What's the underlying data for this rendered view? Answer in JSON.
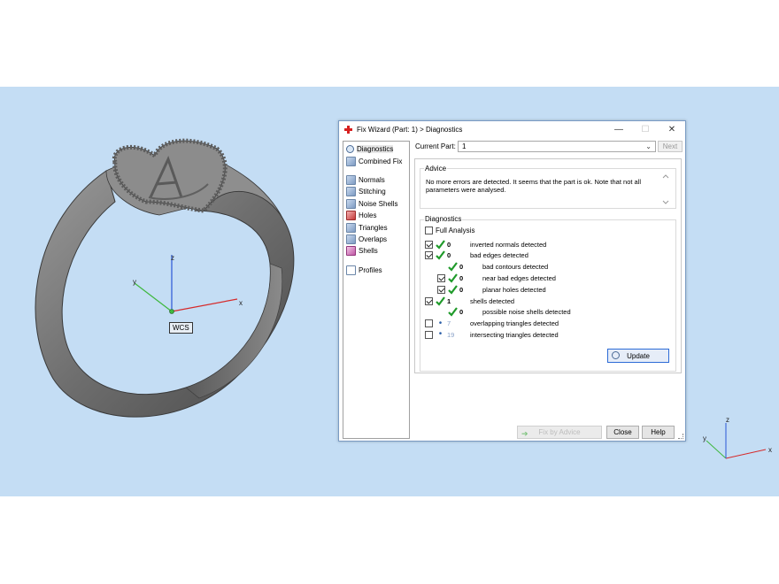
{
  "viewport": {
    "wcs_label": "WCS",
    "axis_labels": {
      "x": "x",
      "y": "y",
      "z": "z"
    },
    "colors": {
      "background": "#c4ddf4",
      "x_axis": "#d62a2a",
      "y_axis": "#3fb83f",
      "z_axis": "#2a56d6"
    }
  },
  "dialog": {
    "title": "Fix Wizard (Part: 1) > Diagnostics",
    "window_buttons": {
      "minimize": "—",
      "maximize": "☐",
      "close": "✕"
    },
    "current_part_label": "Current Part:",
    "current_part_value": "1",
    "next_label": "Next",
    "nav": {
      "group1": [
        {
          "label": "Diagnostics",
          "icon": "magnifier-icon",
          "active": true
        },
        {
          "label": "Combined Fix",
          "icon": "cube-icon"
        }
      ],
      "group2": [
        {
          "label": "Normals",
          "icon": "normals-icon"
        },
        {
          "label": "Stitching",
          "icon": "stitching-icon"
        },
        {
          "label": "Noise Shells",
          "icon": "noise-shells-icon"
        },
        {
          "label": "Holes",
          "icon": "holes-icon"
        },
        {
          "label": "Triangles",
          "icon": "triangles-icon"
        },
        {
          "label": "Overlaps",
          "icon": "overlaps-icon"
        },
        {
          "label": "Shells",
          "icon": "shells-icon"
        }
      ],
      "group3": [
        {
          "label": "Profiles",
          "icon": "document-icon"
        }
      ]
    },
    "advice": {
      "title": "Advice",
      "text": "No more errors are detected. It seems that the part is ok. Note that not all parameters were analysed."
    },
    "diagnostics": {
      "title": "Diagnostics",
      "full_analysis_label": "Full Analysis",
      "rows": [
        {
          "checkbox": true,
          "checked": true,
          "status": "ok",
          "count": "0",
          "label": "inverted normals detected",
          "indent": 0
        },
        {
          "checkbox": true,
          "checked": true,
          "status": "ok",
          "count": "0",
          "label": "bad edges detected",
          "indent": 0
        },
        {
          "checkbox": false,
          "checked": false,
          "status": "ok",
          "count": "0",
          "label": "bad contours detected",
          "indent": 1
        },
        {
          "checkbox": true,
          "checked": true,
          "status": "ok",
          "count": "0",
          "label": "near bad edges detected",
          "indent": 1
        },
        {
          "checkbox": true,
          "checked": true,
          "status": "ok",
          "count": "0",
          "label": "planar holes detected",
          "indent": 1
        },
        {
          "checkbox": true,
          "checked": true,
          "status": "ok",
          "count": "1",
          "label": "shells detected",
          "indent": 0
        },
        {
          "checkbox": false,
          "checked": false,
          "status": "ok",
          "count": "0",
          "label": "possible noise shells detected",
          "indent": 1
        },
        {
          "checkbox": true,
          "checked": false,
          "status": "unknown",
          "count": "7",
          "label": "overlapping triangles detected",
          "indent": 0
        },
        {
          "checkbox": true,
          "checked": false,
          "status": "unknown",
          "count": "19",
          "label": "intersecting triangles detected",
          "indent": 0
        }
      ],
      "update_label": "Update"
    },
    "buttons": {
      "fix_label": "Fix by Advice",
      "close_label": "Close",
      "help_label": "Help"
    }
  }
}
